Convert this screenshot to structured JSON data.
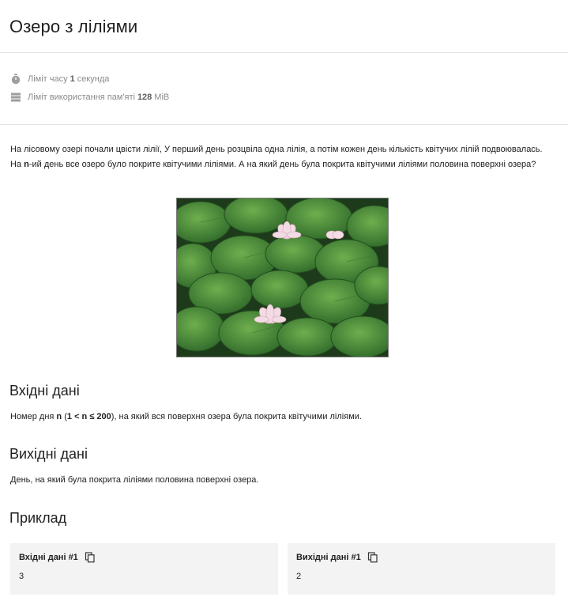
{
  "problem": {
    "title": "Озеро з ліліями"
  },
  "limits": {
    "time_prefix": "Ліміт часу",
    "time_value": "1",
    "time_unit": "секунда",
    "memory_prefix": "Ліміт використання пам'яті",
    "memory_value": "128",
    "memory_unit": "MiB"
  },
  "statement": {
    "part1": "На лісовому озері почали цвісти лілії, У перший день розцвіла одна лілія, а потім кожен день кількість квітучих лілій подвоювалась. На ",
    "bold_n": "n",
    "part2": "-ий день все озеро було покрите квітучими ліліями. А на який день була покрита квітучими ліліями половина поверхні озера?"
  },
  "input_section": {
    "heading": "Вхідні дані",
    "text1": "Номер дня ",
    "bold1": "n",
    "text2": " (",
    "bold2": "1 < n ≤ 200",
    "text3": "), на який вся поверхня озера була покрита квітучими ліліями."
  },
  "output_section": {
    "heading": "Вихідні дані",
    "text": "День, на який була покрита ліліями половина поверхні озера."
  },
  "example": {
    "heading": "Приклад",
    "input_label": "Вхідні дані #1",
    "input_value": "3",
    "output_label": "Вихідні дані #1",
    "output_value": "2"
  },
  "icons": {
    "time": "stopwatch-icon",
    "memory": "memory-stack-icon",
    "copy": "copy-icon"
  },
  "colors": {
    "muted_text": "#8a8a8a",
    "divider": "#e2e2e2",
    "example_bg": "#f3f3f3"
  }
}
